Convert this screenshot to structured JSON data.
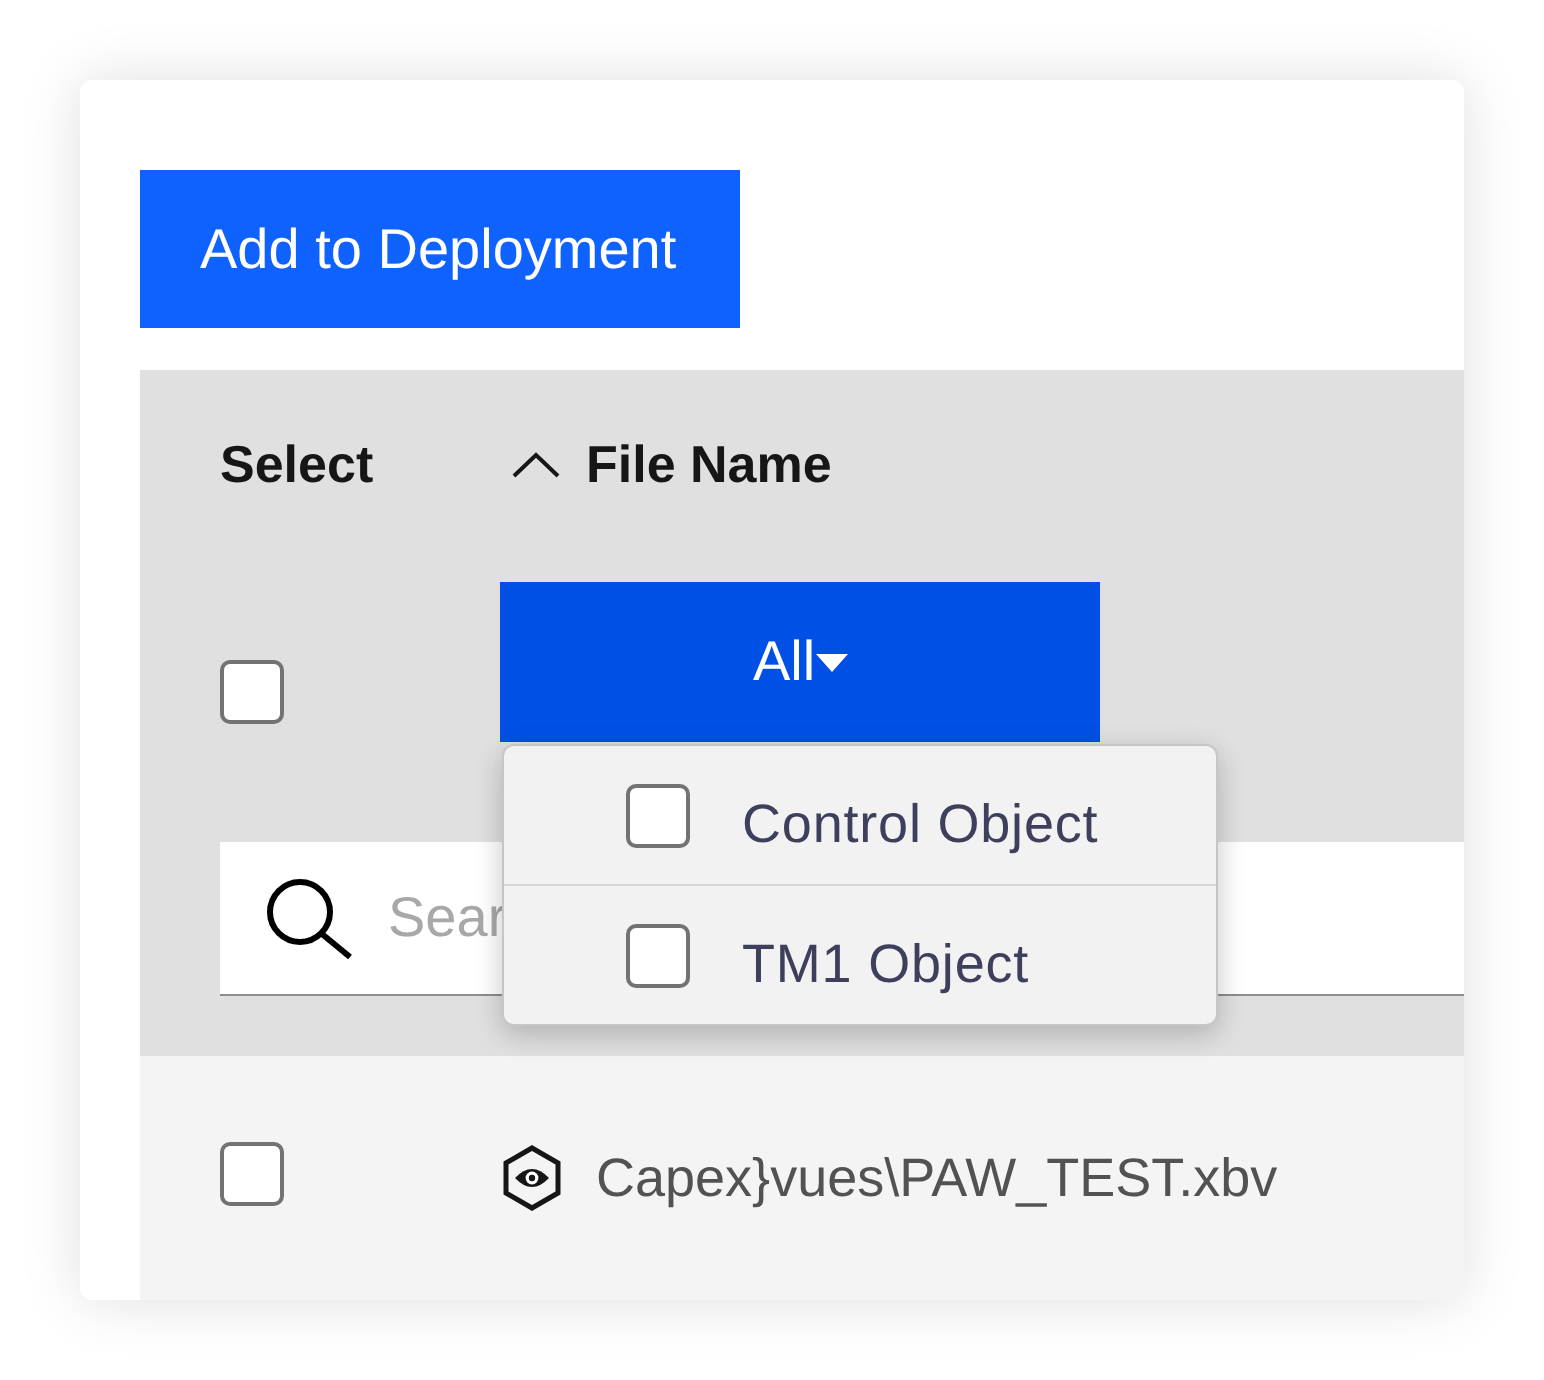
{
  "toolbar": {
    "add_button": "Add to Deployment"
  },
  "table": {
    "columns": [
      {
        "label": "Select"
      },
      {
        "label": "File Name",
        "sort_ascending": true
      }
    ],
    "filter_row": {
      "select_all": {
        "checked": false
      },
      "type_filter": {
        "label": "All",
        "expanded": true,
        "options": [
          {
            "label": "Control Object",
            "checked": false
          },
          {
            "label": "TM1 Object",
            "checked": false
          }
        ]
      },
      "search": {
        "placeholder": "Sear"
      }
    },
    "rows": [
      {
        "checked": false,
        "file_name": "Capex}vues\\PAW_TEST.xbv"
      }
    ]
  }
}
